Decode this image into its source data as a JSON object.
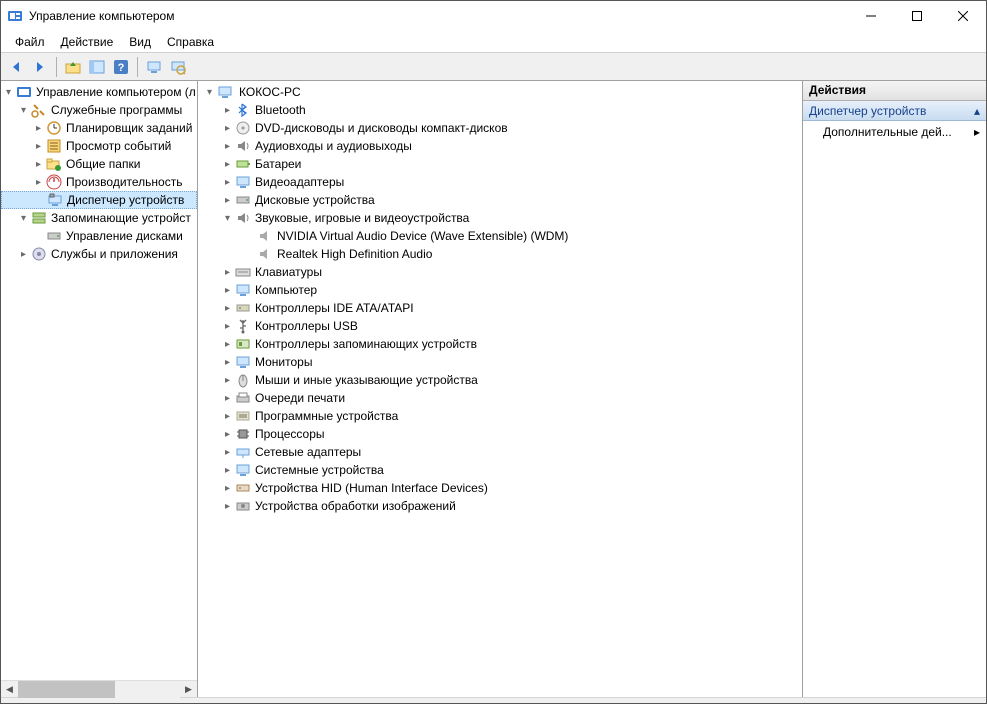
{
  "title": "Управление компьютером",
  "menu": {
    "file": "Файл",
    "action": "Действие",
    "view": "Вид",
    "help": "Справка"
  },
  "leftTree": {
    "root": "Управление компьютером (л",
    "sys_tools": "Служебные программы",
    "task_sched": "Планировщик заданий",
    "event_viewer": "Просмотр событий",
    "shared_folders": "Общие папки",
    "perf": "Производительность",
    "devmgr": "Диспетчер устройств",
    "storage": "Запоминающие устройст",
    "diskmgmt": "Управление дисками",
    "services": "Службы и приложения"
  },
  "devTree": {
    "root": "КОКОС-PC",
    "bluetooth": "Bluetooth",
    "dvd": "DVD-дисководы и дисководы компакт-дисков",
    "audio_io": "Аудиовходы и аудиовыходы",
    "batteries": "Батареи",
    "video": "Видеоадаптеры",
    "disk": "Дисковые устройства",
    "sound": "Звуковые, игровые и видеоустройства",
    "nvidia": "NVIDIA Virtual Audio Device (Wave Extensible) (WDM)",
    "realtek": "Realtek High Definition Audio",
    "keyboards": "Клавиатуры",
    "computer": "Компьютер",
    "ide": "Контроллеры IDE ATA/ATAPI",
    "usb": "Контроллеры USB",
    "storage_ctrl": "Контроллеры запоминающих устройств",
    "monitors": "Мониторы",
    "mice": "Мыши и иные указывающие устройства",
    "print_queues": "Очереди печати",
    "soft_dev": "Программные устройства",
    "cpu": "Процессоры",
    "net": "Сетевые адаптеры",
    "sys_dev": "Системные устройства",
    "hid": "Устройства HID (Human Interface Devices)",
    "imaging": "Устройства обработки изображений"
  },
  "actions": {
    "header": "Действия",
    "section": "Диспетчер устройств",
    "more": "Дополнительные дей..."
  }
}
